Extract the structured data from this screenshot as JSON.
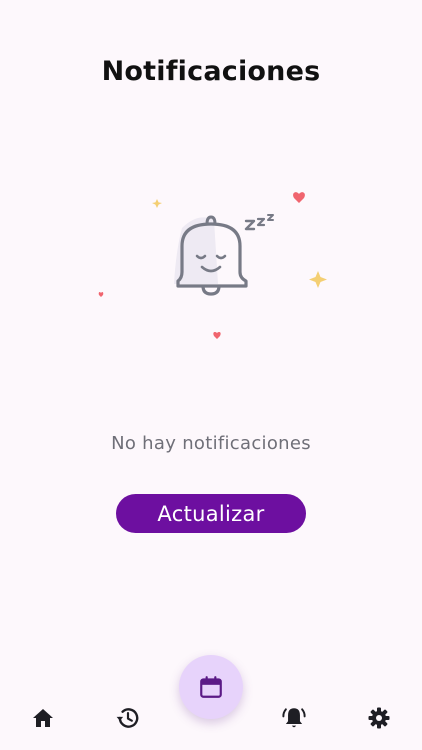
{
  "header": {
    "title": "Notificaciones"
  },
  "empty_state": {
    "illustration": "sleeping-bell-icon",
    "message": "No hay notificaciones",
    "refresh_label": "Actualizar"
  },
  "bottom_nav": {
    "items": [
      {
        "icon": "home-icon"
      },
      {
        "icon": "history-icon"
      },
      {
        "icon": "calendar-icon"
      },
      {
        "icon": "notifications-active-icon"
      },
      {
        "icon": "settings-icon"
      }
    ]
  },
  "colors": {
    "background": "#fdf8fc",
    "primary_button": "#6d0fa0",
    "fab_background": "#e7d3fb",
    "fab_icon": "#5b1a86",
    "title_text": "#111111",
    "muted_text": "#6f6f78",
    "nav_icon": "#1e1e24"
  }
}
